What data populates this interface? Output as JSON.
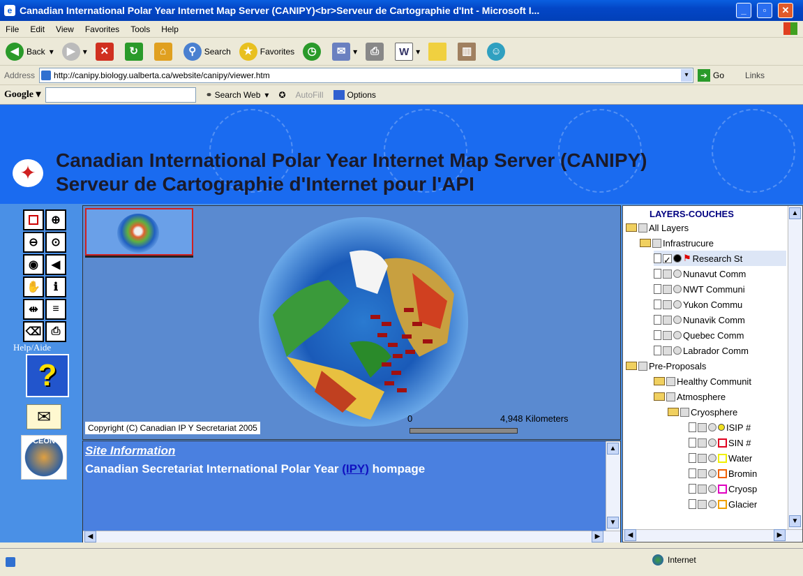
{
  "window": {
    "title": "Canadian International Polar Year Internet Map Server (CANIPY)<br>Serveur de Cartographie d'Int - Microsoft I...",
    "min": "_",
    "max": "▫",
    "close": "✕"
  },
  "menu": [
    "File",
    "Edit",
    "View",
    "Favorites",
    "Tools",
    "Help"
  ],
  "toolbar": {
    "back": "Back",
    "search": "Search",
    "favorites": "Favorites"
  },
  "address": {
    "label": "Address",
    "url": "http://canipy.biology.ualberta.ca/website/canipy/viewer.htm",
    "go": "Go",
    "links": "Links"
  },
  "google": {
    "logo": "Google",
    "search_web": "Search Web",
    "autofill": "AutoFill",
    "options": "Options"
  },
  "banner": {
    "title_en": "Canadian International Polar Year Internet Map Server (CANIPY)",
    "title_fr": "Serveur de Cartographie d'Internet pour l'API"
  },
  "nav": {
    "help": "Help/Aide",
    "logo": "CEON"
  },
  "map": {
    "copyright": "Copyright (C) Canadian IP Y Secretariat 2005",
    "scale_start": "0",
    "scale_end": "4,948 Kilometers"
  },
  "info": {
    "heading": "Site Information",
    "text": "Canadian Secretariat International Polar Year",
    "link": "(IPY)",
    "tail": "hompage"
  },
  "layers": {
    "title": "LAYERS-COUCHES",
    "items": [
      {
        "label": "All Layers"
      },
      {
        "label": "Infrastrucure"
      },
      {
        "label": "Research St"
      },
      {
        "label": "Nunavut Comm"
      },
      {
        "label": "NWT Communi"
      },
      {
        "label": "Yukon Commu"
      },
      {
        "label": "Nunavik Comm"
      },
      {
        "label": "Quebec Comm"
      },
      {
        "label": "Labrador Comm"
      },
      {
        "label": "Pre-Proposals"
      },
      {
        "label": "Healthy Communit"
      },
      {
        "label": "Atmosphere"
      },
      {
        "label": "Cryosphere"
      },
      {
        "label": "ISIP #"
      },
      {
        "label": "SIN #"
      },
      {
        "label": "Water"
      },
      {
        "label": "Bromin"
      },
      {
        "label": "Cryosp"
      },
      {
        "label": "Glacier"
      }
    ]
  },
  "status": {
    "zone": "Internet"
  }
}
